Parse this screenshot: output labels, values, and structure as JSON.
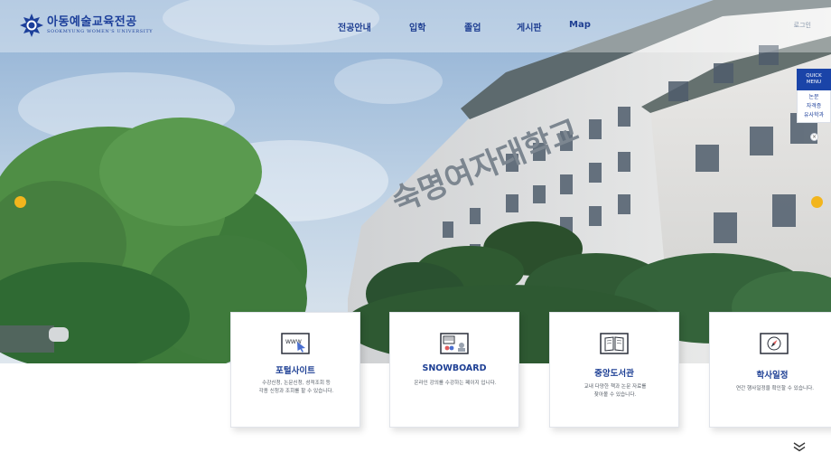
{
  "header": {
    "logo_title": "아동예술교육전공",
    "logo_subtitle": "SOOKMYUNG WOMEN'S UNIVERSITY",
    "login_label": "로그인"
  },
  "nav": {
    "items": [
      "전공안내",
      "입학",
      "졸업",
      "게시판",
      "Map"
    ]
  },
  "hero": {
    "building_sign": "숙명여자대학교"
  },
  "quick_menu": {
    "title_line1": "QUICK",
    "title_line2": "MENU",
    "items": [
      "논문",
      "자격증",
      "유사학과"
    ],
    "close_label": "×"
  },
  "cards": [
    {
      "title": "포털사이트",
      "desc_line1": "수강신청, 논문신청, 성적조회 등",
      "desc_line2": "각종 신청과 조회를 할 수 있습니다.",
      "icon": "www-cursor-icon",
      "icon_text": "WWW"
    },
    {
      "title": "SNOWBOARD",
      "desc_line1": "온라인 강의를 수강하는 페이지 입니다.",
      "desc_line2": "",
      "icon": "video-lecture-icon"
    },
    {
      "title": "중앙도서관",
      "desc_line1": "교내 다양한 책과 논문 자료를",
      "desc_line2": "찾아볼 수 있습니다.",
      "icon": "open-book-icon"
    },
    {
      "title": "학사일정",
      "desc_line1": "연간 행사일정을 확인할 수 있습니다.",
      "desc_line2": "",
      "icon": "compass-icon"
    }
  ],
  "colors": {
    "brand_blue": "#1c3f9a",
    "slider_dot": "#f2b51d",
    "quick_menu_bg": "#1a44a8"
  }
}
